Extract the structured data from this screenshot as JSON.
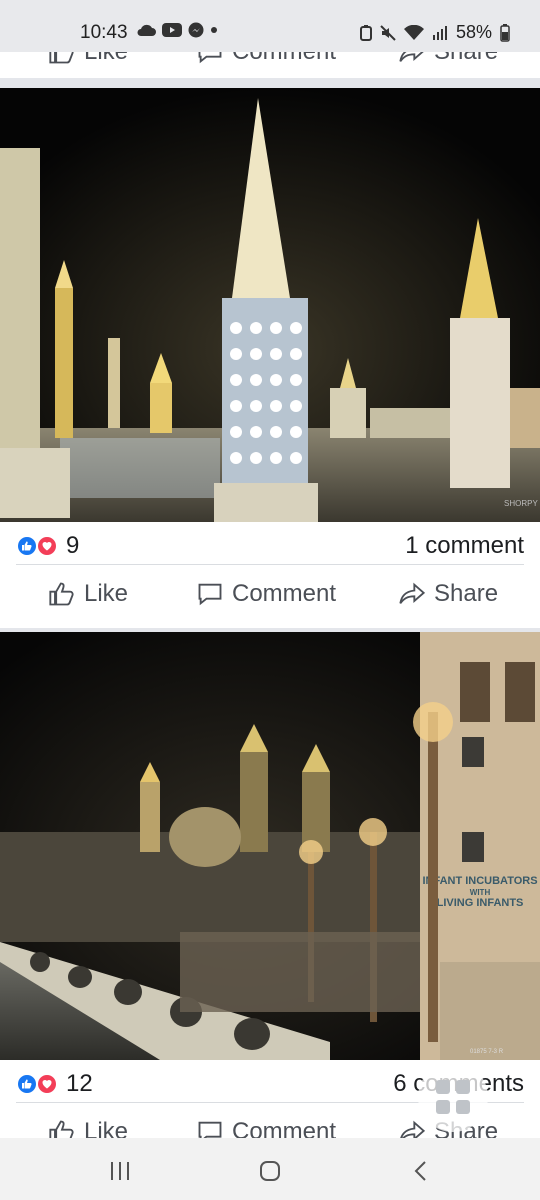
{
  "status_bar": {
    "time": "10:43",
    "notification_icons": [
      "cloud-icon",
      "youtube-icon",
      "messenger-icon",
      "dot-icon"
    ],
    "battery": "58%",
    "system_icons": [
      "battery-saver-icon",
      "mute-icon",
      "wifi-icon",
      "signal-icon",
      "battery-icon"
    ]
  },
  "action_labels": {
    "like": "Like",
    "comment": "Comment",
    "share": "Share"
  },
  "posts": [
    {
      "photo_watermark": "SHORPY",
      "reaction_count": "9",
      "comments": "1 comment"
    },
    {
      "photo_watermark": "01875 7-3 R",
      "sign_text_line1": "INFANT INCUBATORS",
      "sign_text_line2": "WITH",
      "sign_text_line3": "LIVING INFANTS",
      "reaction_count": "12",
      "comments": "6 comments"
    }
  ],
  "colors": {
    "like_blue": "#1877f2",
    "love_red": "#f33e58",
    "text": "#1c1e21",
    "action_text": "#4b4f56"
  }
}
